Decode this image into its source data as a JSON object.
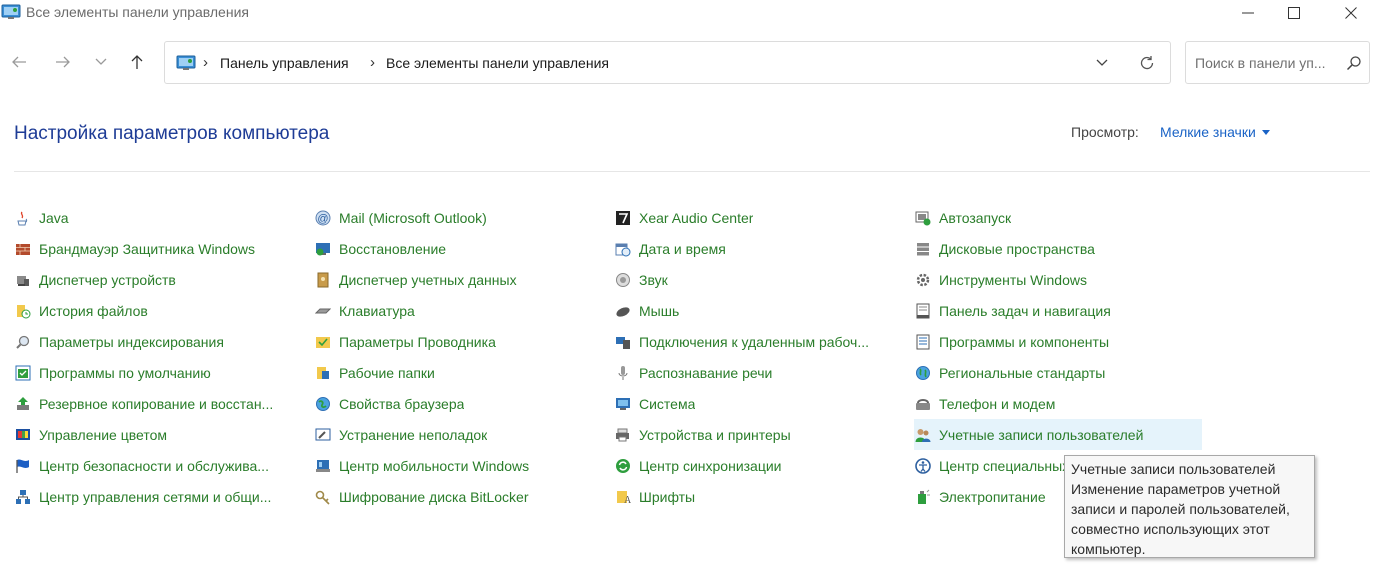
{
  "window": {
    "title": "Все элементы панели управления"
  },
  "address": {
    "crumbs": [
      "Панель управления",
      "Все элементы панели управления"
    ],
    "search_placeholder": "Поиск в панели уп..."
  },
  "header": {
    "title": "Настройка параметров компьютера",
    "view_label": "Просмотр:",
    "view_value": "Мелкие значки"
  },
  "columns": [
    [
      {
        "label": "Java",
        "icon": "java-icon"
      },
      {
        "label": "Брандмауэр Защитника Windows",
        "icon": "firewall-icon"
      },
      {
        "label": "Диспетчер устройств",
        "icon": "device-manager-icon"
      },
      {
        "label": "История файлов",
        "icon": "file-history-icon"
      },
      {
        "label": "Параметры индексирования",
        "icon": "indexing-icon"
      },
      {
        "label": "Программы по умолчанию",
        "icon": "default-programs-icon"
      },
      {
        "label": "Резервное копирование и восстан...",
        "icon": "backup-icon"
      },
      {
        "label": "Управление цветом",
        "icon": "color-management-icon"
      },
      {
        "label": "Центр безопасности и обслужива...",
        "icon": "security-flag-icon"
      },
      {
        "label": "Центр управления сетями и общи...",
        "icon": "network-icon"
      }
    ],
    [
      {
        "label": "Mail (Microsoft Outlook)",
        "icon": "mail-icon"
      },
      {
        "label": "Восстановление",
        "icon": "recovery-icon"
      },
      {
        "label": "Диспетчер учетных данных",
        "icon": "credential-manager-icon"
      },
      {
        "label": "Клавиатура",
        "icon": "keyboard-icon"
      },
      {
        "label": "Параметры Проводника",
        "icon": "explorer-options-icon"
      },
      {
        "label": "Рабочие папки",
        "icon": "work-folders-icon"
      },
      {
        "label": "Свойства браузера",
        "icon": "internet-options-icon"
      },
      {
        "label": "Устранение неполадок",
        "icon": "troubleshooting-icon"
      },
      {
        "label": "Центр мобильности Windows",
        "icon": "mobility-center-icon"
      },
      {
        "label": "Шифрование диска BitLocker",
        "icon": "bitlocker-icon"
      }
    ],
    [
      {
        "label": "Xear Audio Center",
        "icon": "xear-audio-icon"
      },
      {
        "label": "Дата и время",
        "icon": "date-time-icon"
      },
      {
        "label": "Звук",
        "icon": "sound-icon"
      },
      {
        "label": "Мышь",
        "icon": "mouse-icon"
      },
      {
        "label": "Подключения к удаленным рабоч...",
        "icon": "remote-connections-icon"
      },
      {
        "label": "Распознавание речи",
        "icon": "speech-recognition-icon"
      },
      {
        "label": "Система",
        "icon": "system-icon"
      },
      {
        "label": "Устройства и принтеры",
        "icon": "devices-printers-icon"
      },
      {
        "label": "Центр синхронизации",
        "icon": "sync-center-icon"
      },
      {
        "label": "Шрифты",
        "icon": "fonts-icon"
      }
    ],
    [
      {
        "label": "Автозапуск",
        "icon": "autoplay-icon"
      },
      {
        "label": "Дисковые пространства",
        "icon": "storage-spaces-icon"
      },
      {
        "label": "Инструменты Windows",
        "icon": "windows-tools-icon"
      },
      {
        "label": "Панель задач и навигация",
        "icon": "taskbar-icon"
      },
      {
        "label": "Программы и компоненты",
        "icon": "programs-features-icon"
      },
      {
        "label": "Региональные стандарты",
        "icon": "region-icon"
      },
      {
        "label": "Телефон и модем",
        "icon": "phone-modem-icon"
      },
      {
        "label": "Учетные записи пользователей",
        "icon": "user-accounts-icon"
      },
      {
        "label": "Центр специальных возможностей",
        "icon": "ease-of-access-icon"
      },
      {
        "label": "Электропитание",
        "icon": "power-options-icon"
      }
    ]
  ],
  "tooltip": {
    "lines": [
      "Учетные записи пользователей",
      "Изменение параметров учетной",
      "записи и паролей пользователей,",
      "совместно использующих этот",
      "компьютер."
    ]
  }
}
